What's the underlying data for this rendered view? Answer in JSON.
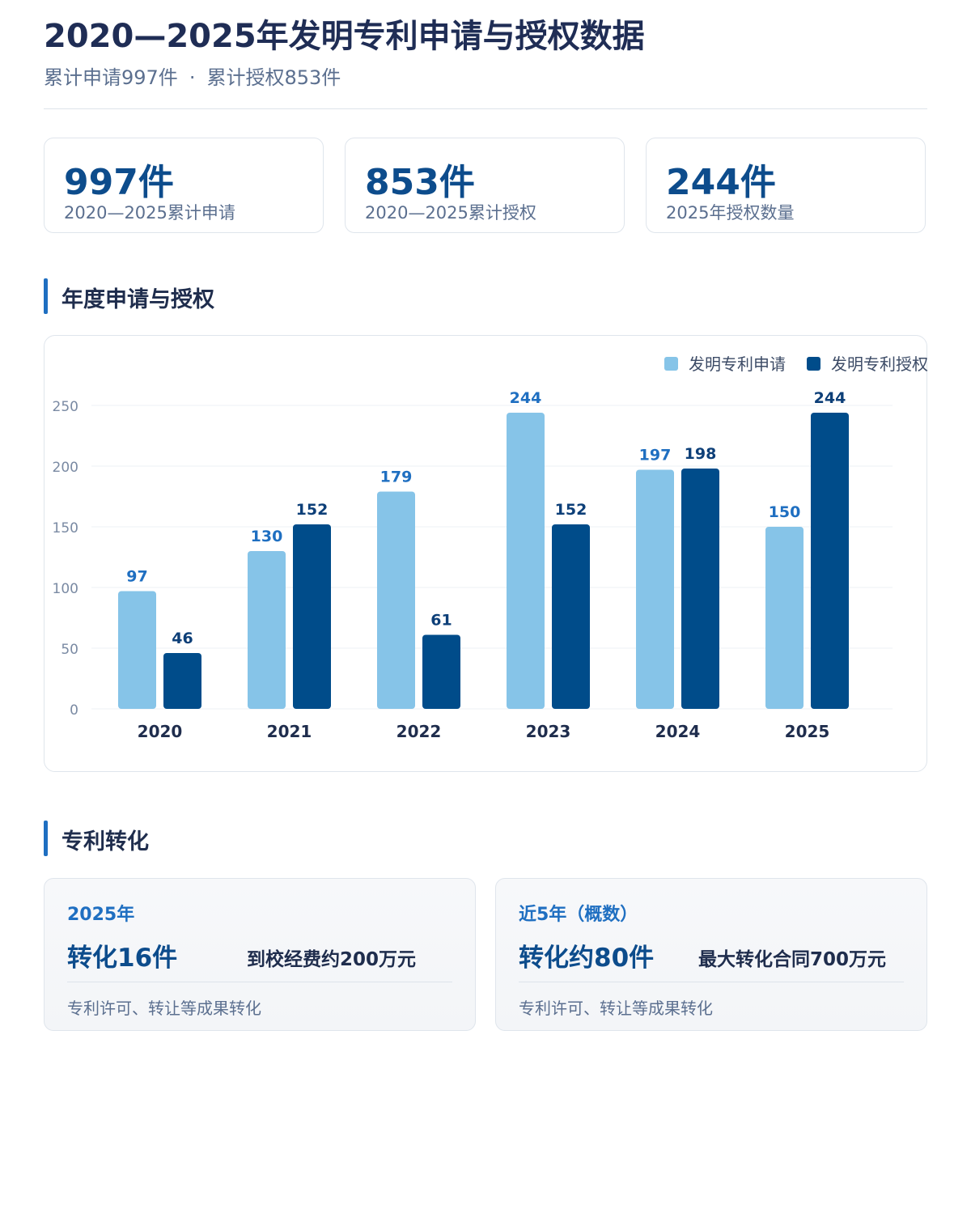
{
  "header": {
    "title": "2020—2025年发明专利申请与授权数据",
    "subtitle_left": "累计申请997件",
    "subtitle_sep": "·",
    "subtitle_right": "累计授权853件"
  },
  "stats": [
    {
      "value": "997件",
      "label": "2020—2025累计申请"
    },
    {
      "value": "853件",
      "label": "2020—2025累计授权"
    },
    {
      "value": "244件",
      "label": "2025年授权数量"
    }
  ],
  "sections": {
    "chart_title": "年度申请与授权",
    "conversion_title": "专利转化"
  },
  "colors": {
    "application": "#86c4e8",
    "grant": "#004c8a",
    "application_label": "#1f6fc1",
    "grant_label": "#0d3f78",
    "accent": "#1f6fc1"
  },
  "chart_data": {
    "type": "bar",
    "title": "",
    "xlabel": "",
    "ylabel": "",
    "categories": [
      "2020",
      "2021",
      "2022",
      "2023",
      "2024",
      "2025"
    ],
    "series": [
      {
        "name": "发明专利申请",
        "values": [
          97,
          130,
          179,
          244,
          197,
          150
        ]
      },
      {
        "name": "发明专利授权",
        "values": [
          46,
          152,
          61,
          152,
          198,
          244
        ]
      }
    ],
    "yticks": [
      0,
      50,
      100,
      150,
      200,
      250
    ],
    "ylim": [
      0,
      250
    ],
    "grid": true,
    "legend_position": "top-right"
  },
  "conversion": [
    {
      "period": "2025年",
      "main": "转化16件",
      "side": "到校经费约200万元",
      "note": "专利许可、转让等成果转化"
    },
    {
      "period": "近5年（概数）",
      "main": "转化约80件",
      "side": "最大转化合同700万元",
      "note": "专利许可、转让等成果转化"
    }
  ]
}
